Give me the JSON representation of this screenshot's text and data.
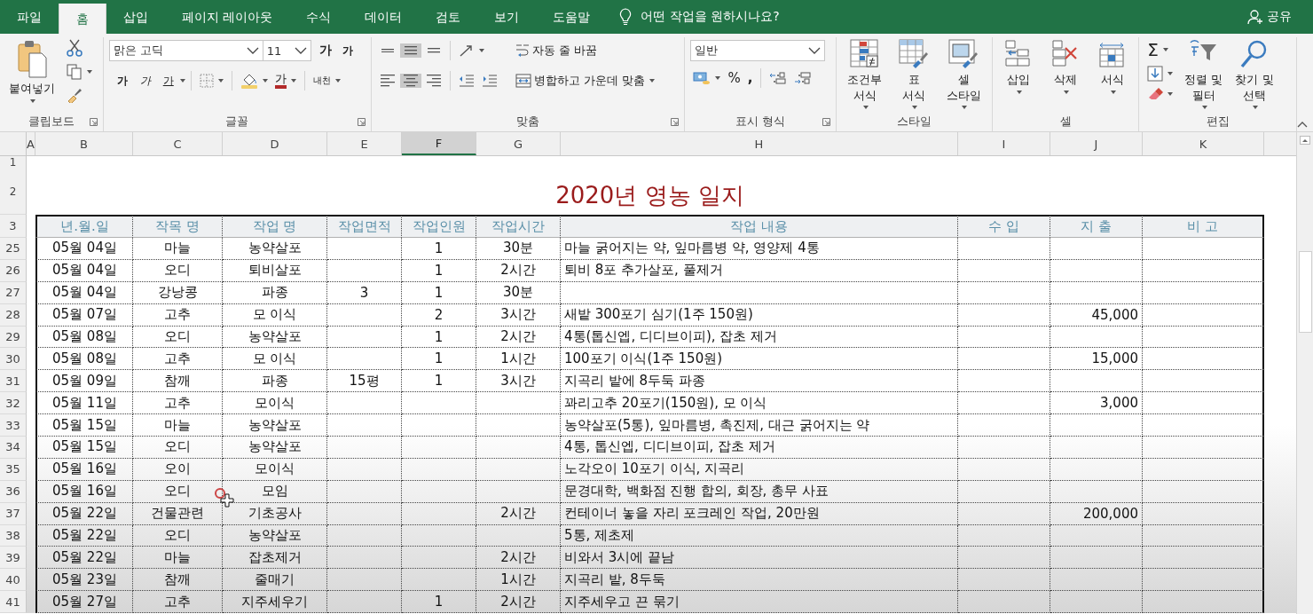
{
  "menu_tabs": [
    {
      "label": "파일",
      "selected": false
    },
    {
      "label": "홈",
      "selected": true
    },
    {
      "label": "삽입",
      "selected": false
    },
    {
      "label": "페이지 레이아웃",
      "selected": false
    },
    {
      "label": "수식",
      "selected": false
    },
    {
      "label": "데이터",
      "selected": false
    },
    {
      "label": "검토",
      "selected": false
    },
    {
      "label": "보기",
      "selected": false
    },
    {
      "label": "도움말",
      "selected": false
    }
  ],
  "tell_me": "어떤 작업을 원하시나요?",
  "share": "공유",
  "ribbon": [
    {
      "kind": "clipboard",
      "label": "클립보드",
      "paste": "붙여넣기"
    },
    {
      "kind": "font",
      "label": "글꼴",
      "font_name": "맑은 고딕",
      "font_size": "11",
      "size_buttons": [
        "가",
        "가"
      ],
      "style_buttons": [
        "가",
        "가",
        "가"
      ],
      "font_color_button": "가",
      "phonetic_button": "내천"
    },
    {
      "kind": "alignment",
      "label": "맞춤",
      "vertical": [
        {
          "selected": false
        },
        {
          "selected": true
        },
        {
          "selected": false
        }
      ],
      "horizontal": [
        {
          "selected": false
        },
        {
          "selected": true
        },
        {
          "selected": false
        }
      ],
      "wrap_text": "자동 줄 바꿈",
      "merge_center": "병합하고 가운데 맞춤"
    },
    {
      "kind": "number",
      "label": "표시 형식",
      "format": "일반",
      "percent": "%",
      "comma": ","
    },
    {
      "kind": "styles",
      "label": "스타일",
      "buttons": [
        "조건부\n서식",
        "표\n서식",
        "셀\n스타일"
      ]
    },
    {
      "kind": "cells",
      "label": "셀",
      "buttons": [
        "삽입",
        "삭제",
        "서식"
      ]
    },
    {
      "kind": "editing",
      "label": "편집",
      "autosum": "Σ",
      "buttons": [
        "정렬 및\n필터",
        "찾기 및\n선택"
      ]
    }
  ],
  "sheet": {
    "column_headers": [
      {
        "label": "A",
        "selected": false
      },
      {
        "label": "B",
        "selected": false
      },
      {
        "label": "C",
        "selected": false
      },
      {
        "label": "D",
        "selected": false
      },
      {
        "label": "E",
        "selected": false
      },
      {
        "label": "F",
        "selected": true
      },
      {
        "label": "G",
        "selected": false
      },
      {
        "label": "H",
        "selected": false
      },
      {
        "label": "I",
        "selected": false
      },
      {
        "label": "J",
        "selected": false
      },
      {
        "label": "K",
        "selected": false
      }
    ],
    "top_rows": [
      {
        "number": "1"
      },
      {
        "number": "2",
        "title": "2020년 영농 일지"
      }
    ],
    "table_header": {
      "number": "3",
      "columns": [
        "년.월.일",
        "작목 명",
        "작업 명",
        "작업면적",
        "작업인원",
        "작업시간",
        "작업 내용",
        "수 입",
        "지 출",
        "비 고"
      ]
    },
    "rows": [
      {
        "number": "25",
        "date": "05월 04일",
        "crop": "마늘",
        "task": "농약살포",
        "workers": "1",
        "hours": "30분",
        "content": "마늘 굵어지는 약, 잎마름병 약, 영양제 4통"
      },
      {
        "number": "26",
        "date": "05월 04일",
        "crop": "오디",
        "task": "퇴비살포",
        "workers": "1",
        "hours": "2시간",
        "content": "퇴비 8포 추가살포, 풀제거"
      },
      {
        "number": "27",
        "date": "05월 04일",
        "crop": "강낭콩",
        "task": "파종",
        "area": "3",
        "workers": "1",
        "hours": "30분"
      },
      {
        "number": "28",
        "date": "05월 07일",
        "crop": "고추",
        "task": "모 이식",
        "workers": "2",
        "hours": "3시간",
        "content": "새밭 300포기 심기(1주 150원)",
        "expense": "45,000"
      },
      {
        "number": "29",
        "date": "05월 08일",
        "crop": "오디",
        "task": "농약살포",
        "workers": "1",
        "hours": "2시간",
        "content": "4통(톱신엡, 디디브이피), 잡초 제거"
      },
      {
        "number": "30",
        "date": "05월 08일",
        "crop": "고추",
        "task": "모 이식",
        "workers": "1",
        "hours": "1시간",
        "content": "100포기 이식(1주 150원)",
        "expense": "15,000"
      },
      {
        "number": "31",
        "date": "05월 09일",
        "crop": "참깨",
        "task": "파종",
        "area": "15평",
        "workers": "1",
        "hours": "3시간",
        "content": "지곡리 밭에 8두둑 파종"
      },
      {
        "number": "32",
        "date": "05월 11일",
        "crop": "고추",
        "task": "모이식",
        "content": "꽈리고추 20포기(150원), 모 이식",
        "expense": "3,000"
      },
      {
        "number": "33",
        "date": "05월 15일",
        "crop": "마늘",
        "task": "농약살포",
        "content": "농약살포(5통), 잎마름병, 촉진제, 대근 굵어지는 약"
      },
      {
        "number": "34",
        "date": "05월 15일",
        "crop": "오디",
        "task": "농약살포",
        "content": "4통, 톱신엡, 디디브이피, 잡초 제거"
      },
      {
        "number": "35",
        "date": "05월 16일",
        "crop": "오이",
        "task": "모이식",
        "content": "노각오이 10포기 이식, 지곡리"
      },
      {
        "number": "36",
        "date": "05월 16일",
        "crop": "오디",
        "task": "모임",
        "content": "문경대학, 백화점 진행 합의, 회장, 총무 사표"
      },
      {
        "number": "37",
        "date": "05월 22일",
        "crop": "건물관련",
        "task": "기초공사",
        "hours": "2시간",
        "content": "컨테이너 놓을 자리 포크레인 작업, 20만원",
        "expense": "200,000"
      },
      {
        "number": "38",
        "date": "05월 22일",
        "crop": "오디",
        "task": "농약살포",
        "content": "5통, 제초제"
      },
      {
        "number": "39",
        "date": "05월 22일",
        "crop": "마늘",
        "task": "잡초제거",
        "hours": "2시간",
        "content": "비와서 3시에 끝남"
      },
      {
        "number": "40",
        "date": "05월 23일",
        "crop": "참깨",
        "task": "줄매기",
        "hours": "1시간",
        "content": "지곡리 밭, 8두둑"
      },
      {
        "number": "41",
        "date": "05월 27일",
        "crop": "고추",
        "task": "지주세우기",
        "workers": "1",
        "hours": "2시간",
        "content": "지주세우고 끈 묶기"
      }
    ]
  }
}
